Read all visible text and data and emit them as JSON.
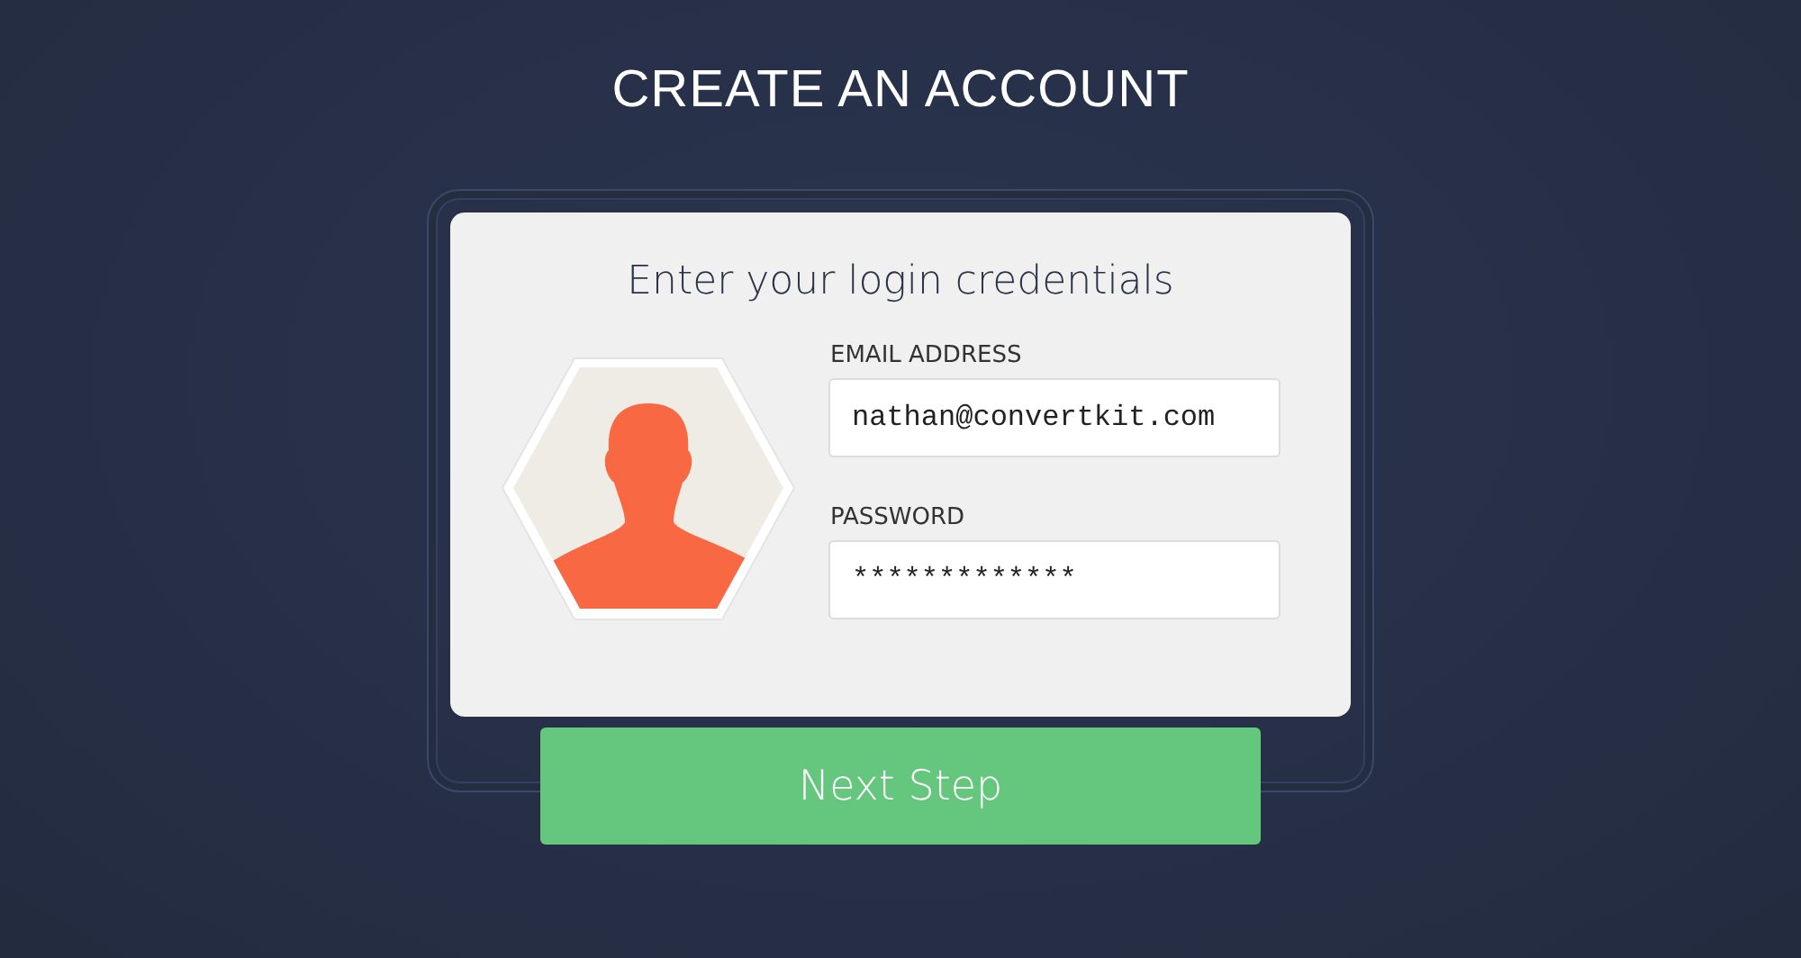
{
  "page_title": "CREATE AN ACCOUNT",
  "card": {
    "heading": "Enter your login credentials",
    "fields": [
      {
        "label": "EMAIL ADDRESS",
        "value": "nathan@convertkit.com"
      },
      {
        "label": "PASSWORD",
        "value": "*************"
      }
    ]
  },
  "button": "Next Step"
}
